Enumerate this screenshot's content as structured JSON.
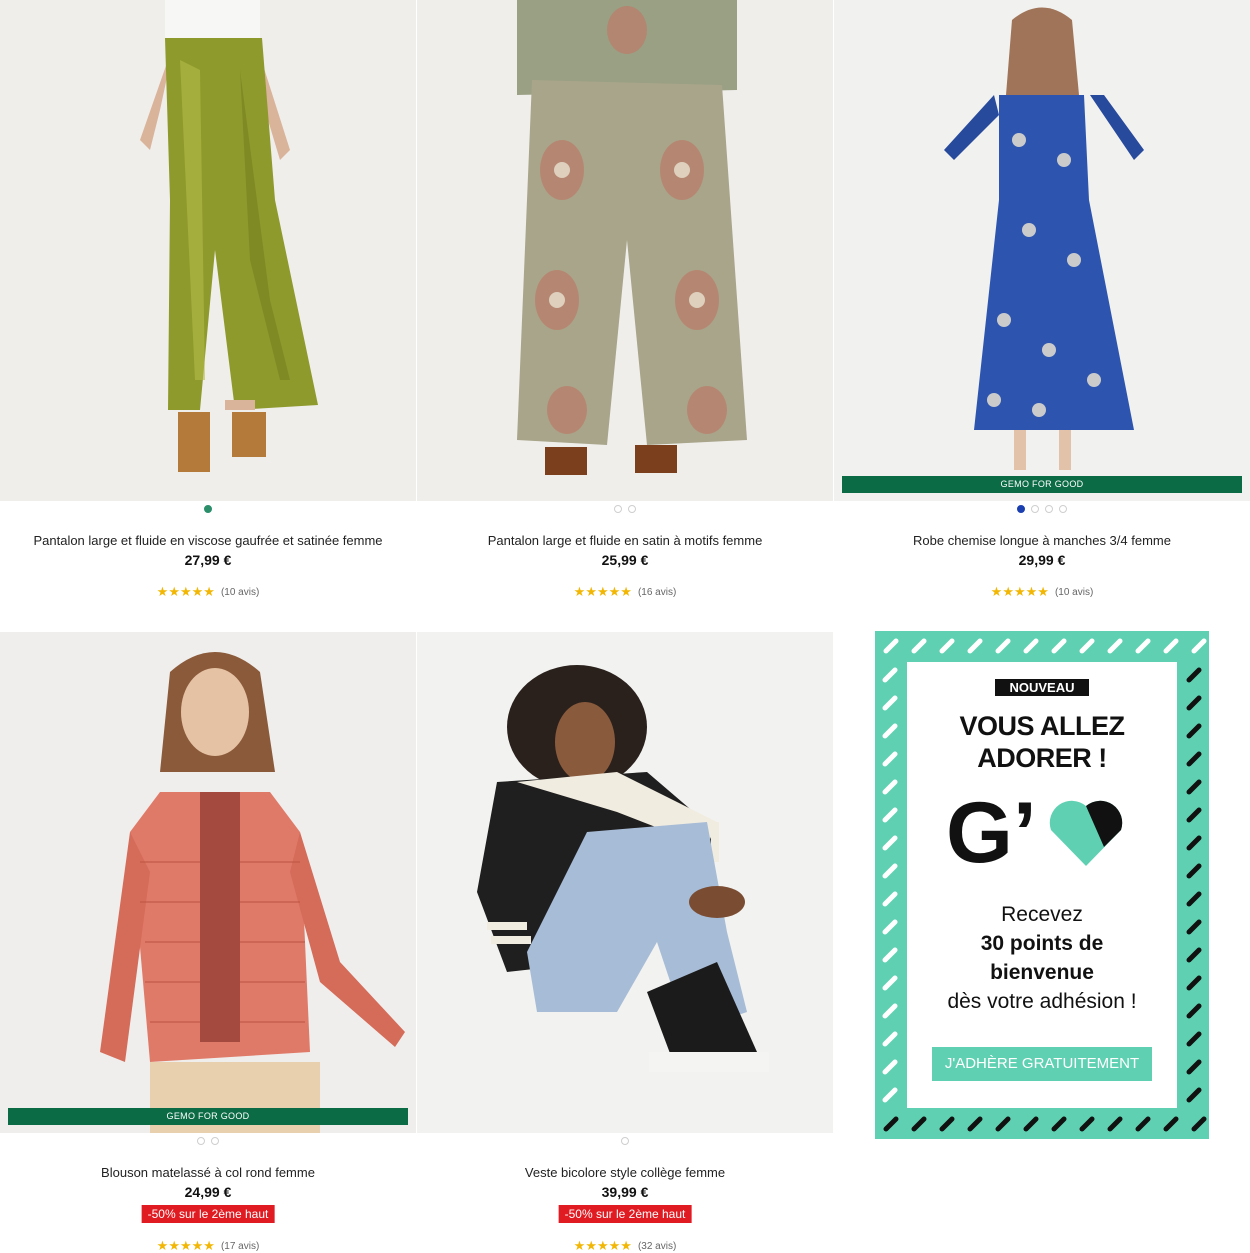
{
  "products": [
    {
      "title": "Pantalon large et fluide en viscose gaufrée et satinée femme",
      "price": "27,99 €",
      "stars": "★★★★★",
      "rating": 4.5,
      "reviews": "(10 avis)",
      "badge": "",
      "promo": "",
      "swatches": 1,
      "active_swatch": 0
    },
    {
      "title": "Pantalon large et fluide en satin à motifs femme",
      "price": "25,99 €",
      "stars": "★★★★★",
      "rating": 5,
      "reviews": "(16 avis)",
      "badge": "",
      "promo": "",
      "swatches": 2,
      "active_swatch": -1
    },
    {
      "title": "Robe chemise longue à manches 3/4 femme",
      "price": "29,99 €",
      "stars": "★★★★★",
      "rating": 4.5,
      "reviews": "(10 avis)",
      "badge": "GEMO FOR GOOD",
      "promo": "",
      "swatches": 4,
      "active_swatch": 0
    },
    {
      "title": "Blouson matelassé à col rond femme",
      "price": "24,99 €",
      "stars": "★★★★★",
      "rating": 5,
      "reviews": "(17 avis)",
      "badge": "GEMO FOR GOOD",
      "promo": "-50% sur le 2ème haut",
      "swatches": 2,
      "active_swatch": -1
    },
    {
      "title": "Veste bicolore style collège femme",
      "price": "39,99 €",
      "stars": "★★★★★",
      "rating": 4.5,
      "reviews": "(32 avis)",
      "badge": "",
      "promo": "-50% sur le 2ème haut",
      "swatches": 1,
      "active_swatch": -1
    }
  ],
  "banner": {
    "tag": "NOUVEAU",
    "headline_1": "VOUS ALLEZ",
    "headline_2": "ADORER !",
    "logo_letter": "G’",
    "text_1": "Recevez",
    "text_2": "30 points de",
    "text_3": "bienvenue",
    "text_4": "dès votre adhésion !",
    "cta": "J'ADHÈRE GRATUITEMENT"
  },
  "colors": {
    "gemo_for_good": "#0b6b45",
    "promo_red": "#e11b22",
    "banner_mint": "#5fd1b2",
    "star_gold": "#f2b705"
  }
}
